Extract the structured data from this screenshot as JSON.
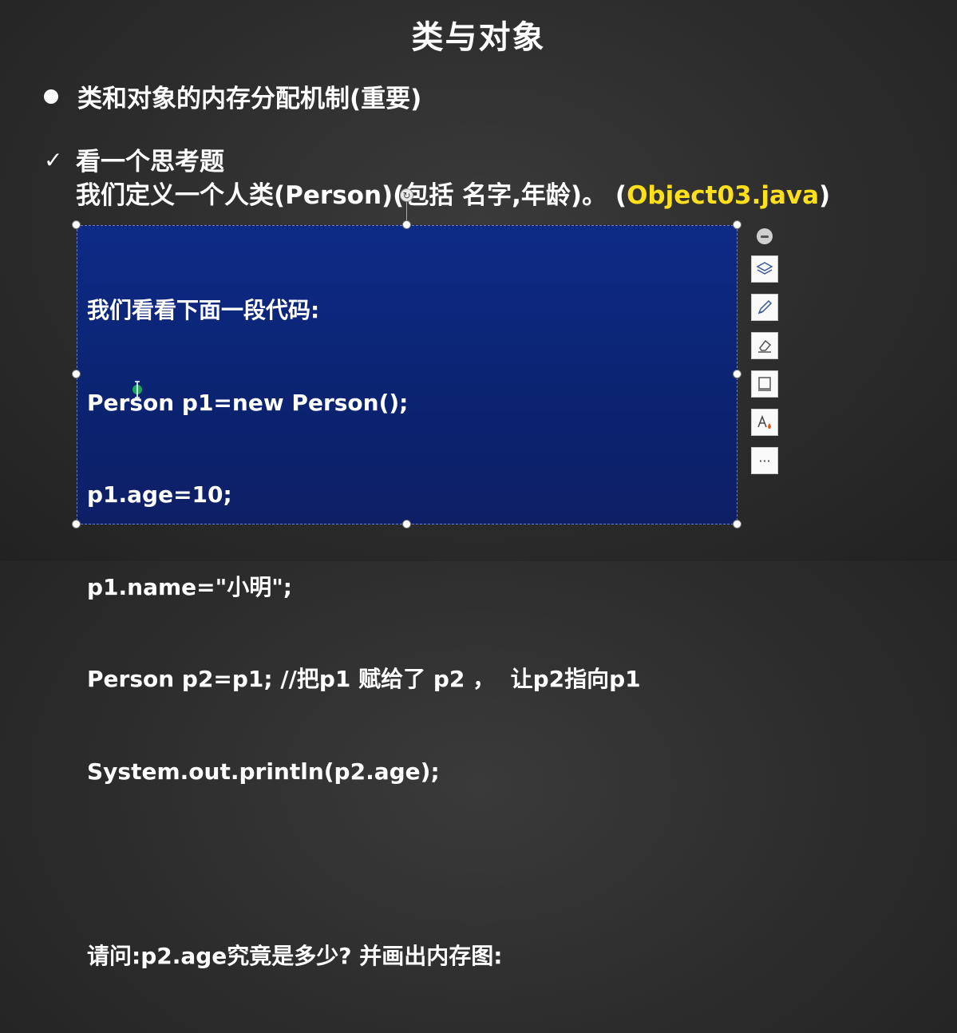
{
  "slide": {
    "title": "类与对象",
    "bullet": "类和对象的内存分配机制(重要)",
    "check_mark": "✓",
    "check_line1": "看一个思考题",
    "check_line2_prefix": "我们定义一个人类(Person)(包括 名字,年龄)。 (",
    "check_line2_highlight": "Object03.java",
    "check_line2_suffix": ")"
  },
  "code_box": {
    "lines": [
      "我们看看下面一段代码:",
      "Person p1=new Person();",
      "p1.age=10;",
      "p1.name=\"小明\";",
      "Person p2=p1; //把p1 赋给了 p2 ，  让p2指向p1",
      "System.out.println(p2.age);",
      "",
      "请问:p2.age究竟是多少? 并画出内存图:"
    ]
  },
  "toolbar": {
    "more_label": "···"
  },
  "colors": {
    "background": "#2c2c2c",
    "code_box_bg": "#0b2370",
    "highlight": "#ffe01a"
  },
  "icons": [
    "collapse-icon",
    "layers-icon",
    "pen-icon",
    "eraser-icon",
    "frame-icon",
    "text-format-icon",
    "more-icon"
  ]
}
